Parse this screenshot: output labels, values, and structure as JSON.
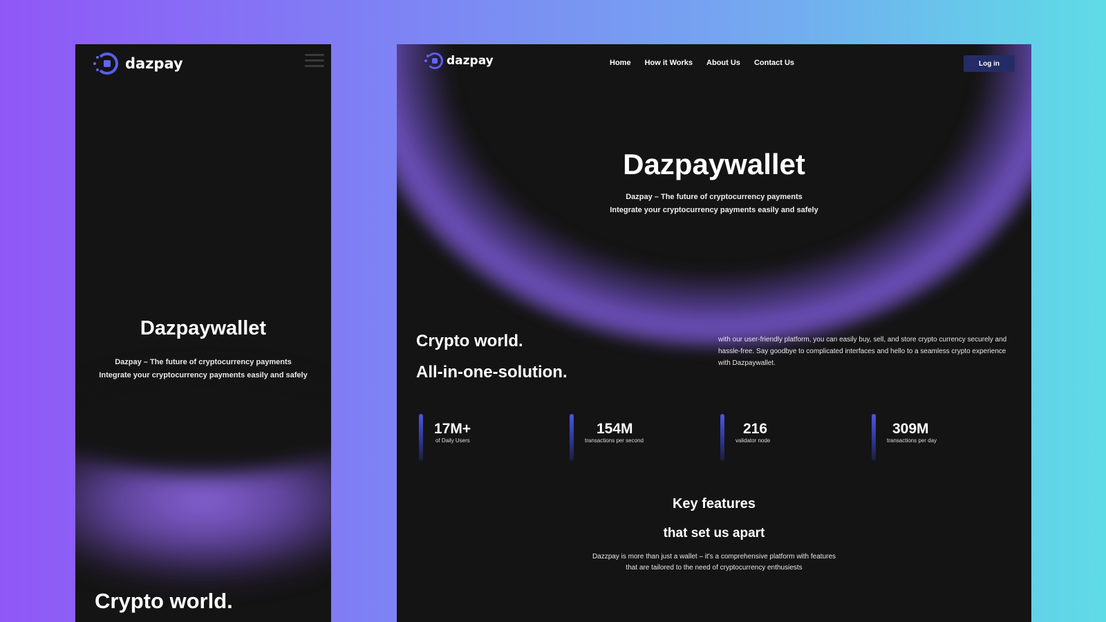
{
  "mobile": {
    "logo_text": "dazpay",
    "hero_title": "Dazpaywallet",
    "hero_line1": "Dazpay – The future of cryptocurrency payments",
    "hero_line2": "Integrate your cryptocurrency payments easily and safely",
    "section_title": "Crypto world."
  },
  "desktop": {
    "logo_text": "dazpay",
    "nav": [
      "Home",
      "How it Works",
      "About Us",
      "Contact Us"
    ],
    "login_label": "Log in",
    "hero_title": "Dazpaywallet",
    "hero_line1": "Dazpay – The future of cryptocurrency payments",
    "hero_line2": "Integrate your cryptocurrency payments easily and safely",
    "section_title_1": "Crypto world.",
    "section_title_2": "All-in-one-solution.",
    "section_paragraph": "with our user-friendly platform, you can easily buy, sell, and store crypto currency securely and hassle-free. Say goodbye to complicated interfaces and hello to a seamless crypto experience with Dazpaywallet.",
    "stats": [
      {
        "value": "17M+",
        "label": "of Daily Users"
      },
      {
        "value": "154M",
        "label": "transactions per second"
      },
      {
        "value": "216",
        "label": "validator node"
      },
      {
        "value": "309M",
        "label": "transactions per day"
      }
    ],
    "features_title": "Key features",
    "features_subtitle": "that set us apart",
    "features_line1": "Dazzpay is more than just a wallet – it's a comprehensive platform with features",
    "features_line2": "that are tailored to the need of cryptocurrency enthusiests"
  },
  "colors": {
    "accent": "#5a5ef0",
    "background": "#141414",
    "glow": "#8c68e2",
    "login_button": "#242c66"
  }
}
